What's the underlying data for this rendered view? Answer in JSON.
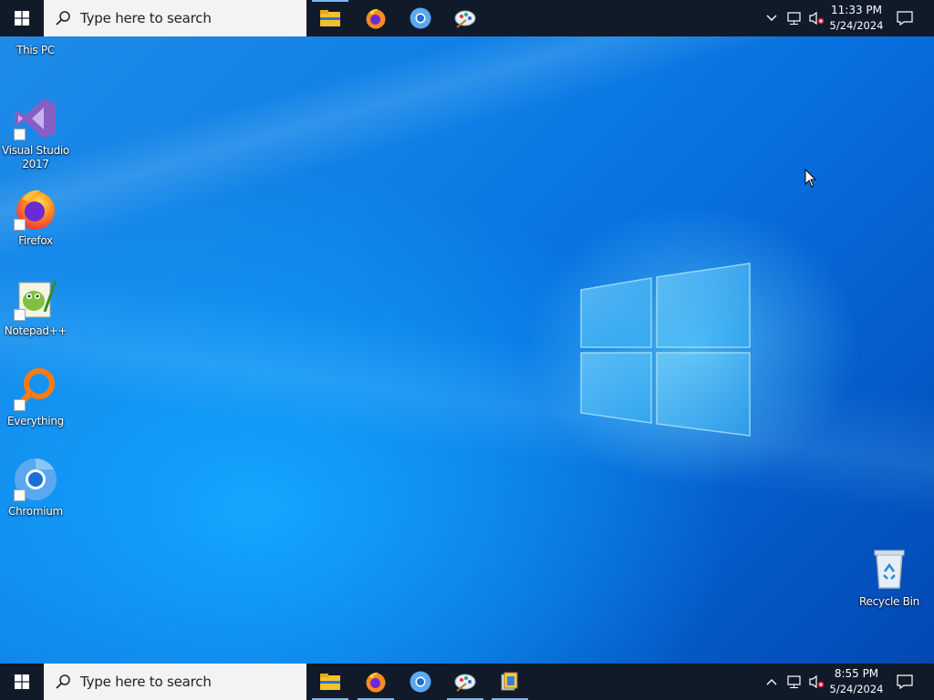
{
  "desktop": {
    "icons": [
      {
        "name": "this-pc",
        "label": "This PC"
      },
      {
        "name": "visual-studio-2017",
        "label": "Visual Studio 2017"
      },
      {
        "name": "firefox",
        "label": "Firefox"
      },
      {
        "name": "notepad-plus-plus",
        "label": "Notepad++"
      },
      {
        "name": "everything",
        "label": "Everything"
      },
      {
        "name": "chromium",
        "label": "Chromium"
      },
      {
        "name": "recycle-bin",
        "label": "Recycle Bin"
      }
    ]
  },
  "taskbar_top": {
    "search_placeholder": "Type here to search",
    "apps": [
      "file-explorer",
      "firefox",
      "chromium",
      "paint"
    ],
    "clock": {
      "time": "11:33 PM",
      "date": "5/24/2024"
    }
  },
  "taskbar_bottom": {
    "search_placeholder": "Type here to search",
    "apps": [
      "file-explorer",
      "firefox",
      "chromium",
      "paint",
      "system-app"
    ],
    "clock": {
      "time": "8:55 PM",
      "date": "5/24/2024"
    }
  },
  "colors": {
    "taskbar": "#101a29",
    "accent": "#7fb7ee",
    "wallpaper": "#0f7fe6"
  }
}
